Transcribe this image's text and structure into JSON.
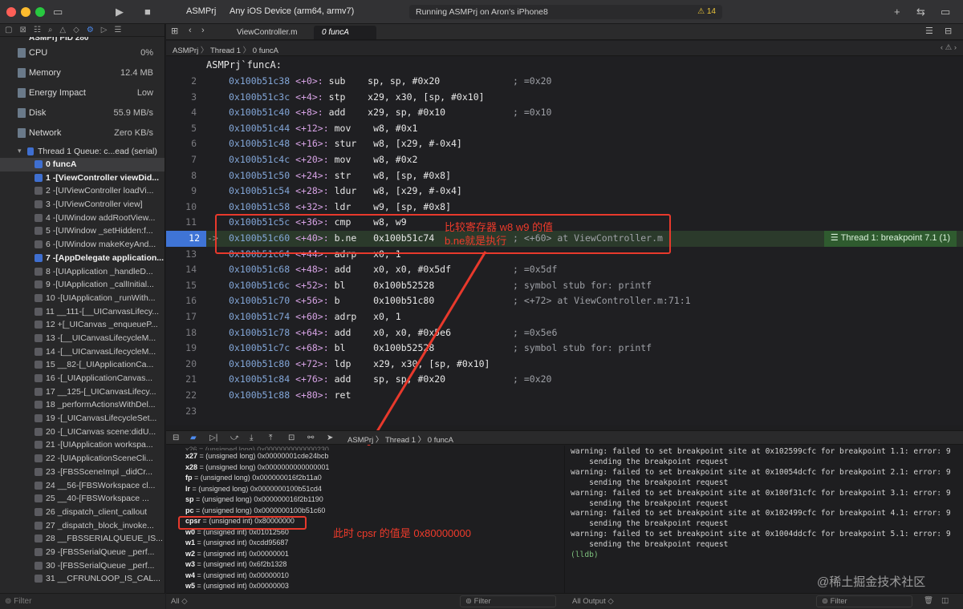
{
  "toolbar": {
    "scheme": "ASMPrj",
    "device": "Any iOS Device (arm64, armv7)",
    "status": "Running ASMPrj on Aron's iPhone8",
    "warnings": "14"
  },
  "debug_nav": {
    "process": "ASMPrj PID 280",
    "gauges": [
      {
        "label": "CPU",
        "value": "0%"
      },
      {
        "label": "Memory",
        "value": "12.4 MB"
      },
      {
        "label": "Energy Impact",
        "value": "Low"
      },
      {
        "label": "Disk",
        "value": "55.9 MB/s"
      },
      {
        "label": "Network",
        "value": "Zero KB/s"
      }
    ],
    "thread": "Thread 1 Queue: c...ead (serial)",
    "frames": [
      "0 funcA",
      "1 -[ViewController viewDid...",
      "2 -[UIViewController loadVi...",
      "3 -[UIViewController view]",
      "4 -[UIWindow addRootView...",
      "5 -[UIWindow _setHidden:f...",
      "6 -[UIWindow makeKeyAnd...",
      "7 -[AppDelegate application...",
      "8 -[UIApplication _handleD...",
      "9 -[UIApplication _callInitial...",
      "10 -[UIApplication _runWith...",
      "11 __111-[__UICanvasLifecy...",
      "12 +[_UICanvas _enqueueP...",
      "13 -[__UICanvasLifecycleM...",
      "14 -[__UICanvasLifecycleM...",
      "15 __82-[_UIApplicationCa...",
      "16 -[_UIApplicationCanvas...",
      "17 __125-[_UICanvasLifecy...",
      "18 _performActionsWithDel...",
      "19 -[_UICanvasLifecycleSet...",
      "20 -[_UICanvas scene:didU...",
      "21 -[UIApplication workspa...",
      "22 -[UIApplicationSceneCli...",
      "23 -[FBSSceneImpl _didCr...",
      "24 __56-[FBSWorkspace cl...",
      "25 __40-[FBSWorkspace ...",
      "26 _dispatch_client_callout",
      "27 _dispatch_block_invoke...",
      "28 __FBSSERIALQUEUE_IS...",
      "29 -[FBSSerialQueue _perf...",
      "30 -[FBSSerialQueue _perf...",
      "31 __CFRUNLOOP_IS_CAL..."
    ],
    "filter_placeholder": "Filter"
  },
  "tabs": [
    "ViewController.m",
    "0 funcA"
  ],
  "jumpbar": [
    "ASMPrj",
    "Thread 1",
    "0 funcA"
  ],
  "code": {
    "title": "ASMPrj`funcA:",
    "lines": [
      {
        "n": "2",
        "addr": "0x100b51c38",
        "off": "<+0>:",
        "op": "sub ",
        "args": "sp, sp, #0x20",
        "cmt": "; =0x20"
      },
      {
        "n": "3",
        "addr": "0x100b51c3c",
        "off": "<+4>:",
        "op": "stp ",
        "args": "x29, x30, [sp, #0x10]",
        "cmt": ""
      },
      {
        "n": "4",
        "addr": "0x100b51c40",
        "off": "<+8>:",
        "op": "add ",
        "args": "x29, sp, #0x10",
        "cmt": "; =0x10"
      },
      {
        "n": "5",
        "addr": "0x100b51c44",
        "off": "<+12>:",
        "op": "mov ",
        "args": "w8, #0x1",
        "cmt": ""
      },
      {
        "n": "6",
        "addr": "0x100b51c48",
        "off": "<+16>:",
        "op": "stur",
        "args": "w8, [x29, #-0x4]",
        "cmt": ""
      },
      {
        "n": "7",
        "addr": "0x100b51c4c",
        "off": "<+20>:",
        "op": "mov ",
        "args": "w8, #0x2",
        "cmt": ""
      },
      {
        "n": "8",
        "addr": "0x100b51c50",
        "off": "<+24>:",
        "op": "str ",
        "args": "w8, [sp, #0x8]",
        "cmt": ""
      },
      {
        "n": "9",
        "addr": "0x100b51c54",
        "off": "<+28>:",
        "op": "ldur",
        "args": "w8, [x29, #-0x4]",
        "cmt": ""
      },
      {
        "n": "10",
        "addr": "0x100b51c58",
        "off": "<+32>:",
        "op": "ldr ",
        "args": "w9, [sp, #0x8]",
        "cmt": ""
      },
      {
        "n": "11",
        "addr": "0x100b51c5c",
        "off": "<+36>:",
        "op": "cmp ",
        "args": "w8, w9",
        "cmt": ""
      },
      {
        "n": "12",
        "addr": "0x100b51c60",
        "off": "<+40>:",
        "op": "b.ne",
        "args": "0x100b51c74",
        "cmt": "; <+60> at ViewController.m"
      },
      {
        "n": "13",
        "addr": "0x100b51c64",
        "off": "<+44>:",
        "op": "adrp",
        "args": "x0, 1",
        "cmt": ""
      },
      {
        "n": "14",
        "addr": "0x100b51c68",
        "off": "<+48>:",
        "op": "add ",
        "args": "x0, x0, #0x5df",
        "cmt": "; =0x5df"
      },
      {
        "n": "15",
        "addr": "0x100b51c6c",
        "off": "<+52>:",
        "op": "bl  ",
        "args": "0x100b52528",
        "cmt": "; symbol stub for: printf"
      },
      {
        "n": "16",
        "addr": "0x100b51c70",
        "off": "<+56>:",
        "op": "b   ",
        "args": "0x100b51c80",
        "cmt": "; <+72> at ViewController.m:71:1"
      },
      {
        "n": "17",
        "addr": "0x100b51c74",
        "off": "<+60>:",
        "op": "adrp",
        "args": "x0, 1",
        "cmt": ""
      },
      {
        "n": "18",
        "addr": "0x100b51c78",
        "off": "<+64>:",
        "op": "add ",
        "args": "x0, x0, #0x5e6",
        "cmt": "; =0x5e6"
      },
      {
        "n": "19",
        "addr": "0x100b51c7c",
        "off": "<+68>:",
        "op": "bl  ",
        "args": "0x100b52528",
        "cmt": "; symbol stub for: printf"
      },
      {
        "n": "20",
        "addr": "0x100b51c80",
        "off": "<+72>:",
        "op": "ldp ",
        "args": "x29, x30, [sp, #0x10]",
        "cmt": ""
      },
      {
        "n": "21",
        "addr": "0x100b51c84",
        "off": "<+76>:",
        "op": "add ",
        "args": "sp, sp, #0x20",
        "cmt": "; =0x20"
      },
      {
        "n": "22",
        "addr": "0x100b51c88",
        "off": "<+80>:",
        "op": "ret ",
        "args": "",
        "cmt": ""
      },
      {
        "n": "23",
        "addr": "",
        "off": "",
        "op": "",
        "args": "",
        "cmt": ""
      }
    ],
    "breakpoint_label": "Thread 1: breakpoint 7.1 (1)"
  },
  "annotations": {
    "compare_line1": "比较寄存器 w8 w9 的值",
    "compare_line2": "b.ne就是执行",
    "cpsr_note": "此时 cpsr 的值是 0x80000000"
  },
  "debug_bar": {
    "breadcrumb": "ASMPrj 〉 Thread 1 〉 0 funcA"
  },
  "variables": [
    {
      "name": "x27",
      "value": " = (unsigned long) 0x00000001cde24bcb"
    },
    {
      "name": "x28",
      "value": " = (unsigned long) 0x0000000000000001"
    },
    {
      "name": "fp",
      "value": " = (unsigned long) 0x000000016f2b11a0"
    },
    {
      "name": "lr",
      "value": " = (unsigned long) 0x0000000100b51cd4"
    },
    {
      "name": "sp",
      "value": " = (unsigned long) 0x000000016f2b1190"
    },
    {
      "name": "pc",
      "value": " = (unsigned long) 0x0000000100b51c60"
    },
    {
      "name": "cpsr",
      "value": " = (unsigned int) 0x80000000"
    },
    {
      "name": "w0",
      "value": " = (unsigned int) 0x01012560"
    },
    {
      "name": "w1",
      "value": " = (unsigned int) 0xcdd95687"
    },
    {
      "name": "w2",
      "value": " = (unsigned int) 0x00000001"
    },
    {
      "name": "w3",
      "value": " = (unsigned int) 0x6f2b1328"
    },
    {
      "name": "w4",
      "value": " = (unsigned int) 0x00000010"
    },
    {
      "name": "w5",
      "value": " = (unsigned int) 0x00000003"
    }
  ],
  "console": [
    "warning: failed to set breakpoint site at 0x102599cfc for breakpoint 1.1: error: 9",
    "    sending the breakpoint request",
    "warning: failed to set breakpoint site at 0x10054dcfc for breakpoint 2.1: error: 9",
    "    sending the breakpoint request",
    "warning: failed to set breakpoint site at 0x100f31cfc for breakpoint 3.1: error: 9",
    "    sending the breakpoint request",
    "warning: failed to set breakpoint site at 0x102499cfc for breakpoint 4.1: error: 9",
    "    sending the breakpoint request",
    "warning: failed to set breakpoint site at 0x1004ddcfc for breakpoint 5.1: error: 9",
    "    sending the breakpoint request",
    "(lldb)"
  ],
  "bottom": {
    "vars_scope": "All ◇",
    "vars_filter": "Filter",
    "console_scope": "All Output ◇",
    "console_filter": "Filter"
  },
  "watermark": "@稀土掘金技术社区",
  "colors": {
    "accent": "#3f74d6",
    "annotation": "#e8392c",
    "breakpoint_bg": "#2f5b2f"
  }
}
